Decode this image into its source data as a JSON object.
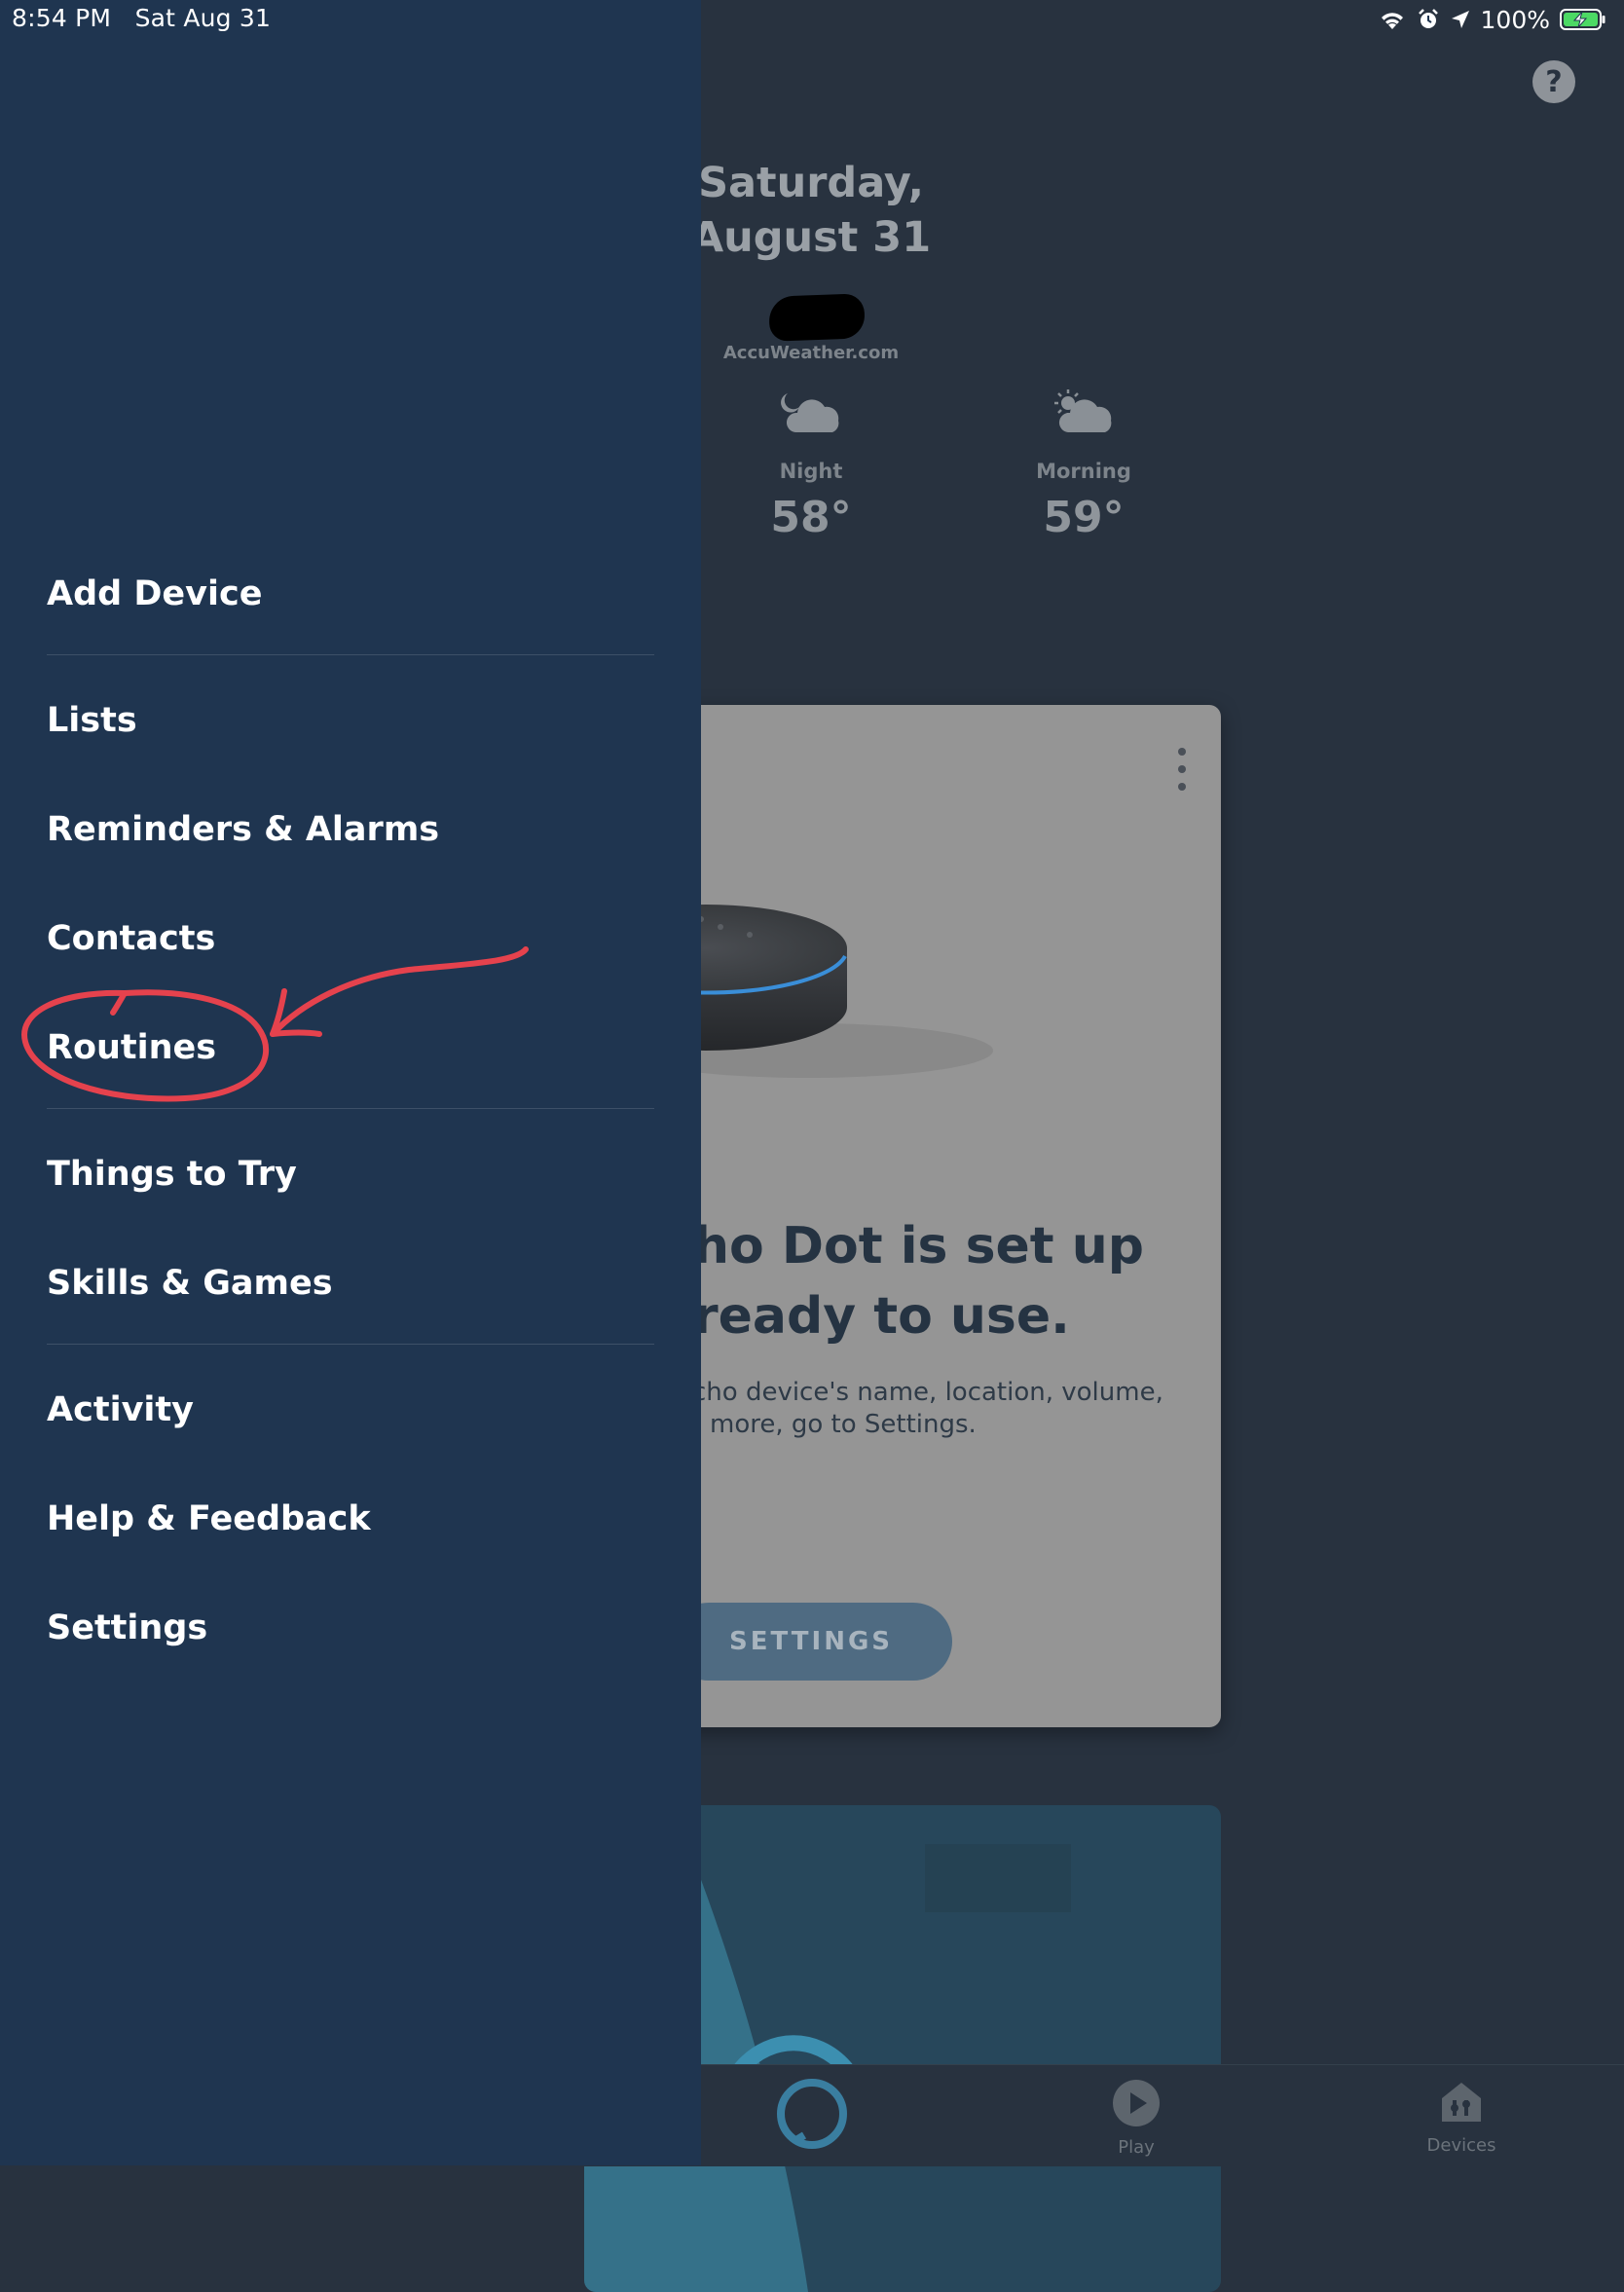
{
  "status_bar": {
    "time": "8:54 PM",
    "date": "Sat Aug 31",
    "battery": "100%",
    "icons": [
      "wifi-icon",
      "alarm-icon",
      "location-icon",
      "battery-charging-icon"
    ]
  },
  "main": {
    "help_label": "?",
    "date_line1": "Saturday,",
    "date_line2": "August 31",
    "weather_source": "AccuWeather.com",
    "forecast": [
      {
        "label": "Night",
        "temp": "58°",
        "icon": "moon-cloud-icon"
      },
      {
        "label": "Morning",
        "temp": "59°",
        "icon": "sun-cloud-icon"
      }
    ],
    "card": {
      "title_line1": "ho Dot is set up",
      "title_line2": "ready to use.",
      "text_line1": "cho device's name, location, volume,",
      "text_line2": "more, go to Settings.",
      "button_label": "SETTINGS"
    },
    "tabs": [
      {
        "label": "",
        "icon": "alexa-icon"
      },
      {
        "label": "Play",
        "icon": "play-icon"
      },
      {
        "label": "Devices",
        "icon": "devices-icon"
      }
    ]
  },
  "drawer": {
    "items": [
      {
        "label": "Add Device"
      },
      {
        "label": "Lists"
      },
      {
        "label": "Reminders & Alarms"
      },
      {
        "label": "Contacts"
      },
      {
        "label": "Routines"
      },
      {
        "label": "Things to Try"
      },
      {
        "label": "Skills & Games"
      },
      {
        "label": "Activity"
      },
      {
        "label": "Help & Feedback"
      },
      {
        "label": "Settings"
      }
    ]
  },
  "colors": {
    "drawer_bg": "#1f3550",
    "page_bg": "#28323f",
    "annotation": "#e5424d"
  }
}
